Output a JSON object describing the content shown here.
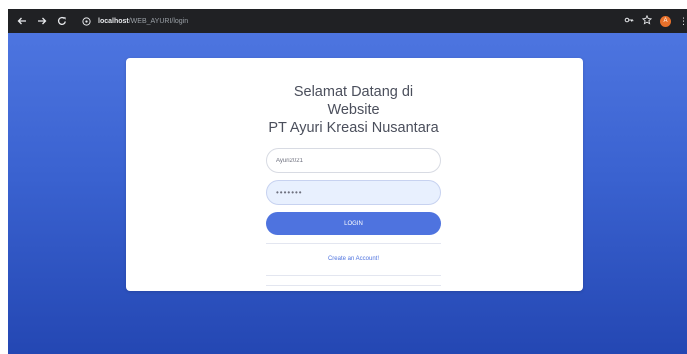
{
  "browser": {
    "url_host": "localhost",
    "url_path": "/WEB_AYURI/login",
    "profile_initial": "A",
    "menu_glyph": "⋮"
  },
  "icons": {
    "back": "arrow-left-icon",
    "forward": "arrow-right-icon",
    "reload": "reload-icon",
    "site_info": "info-icon",
    "key": "key-icon",
    "star": "star-icon"
  },
  "colors": {
    "page_gradient_top": "#4d75e0",
    "page_gradient_bottom": "#2447b3",
    "button": "#4e73df",
    "link": "#4e73df"
  },
  "login": {
    "title_line1": "Selamat Datang di Website",
    "title_line2": "PT Ayuri Kreasi Nusantara",
    "username_value": "Ayuri2021",
    "password_value": "•••••••",
    "login_button": "LOGIN",
    "create_account_link": "Create an Account!"
  }
}
